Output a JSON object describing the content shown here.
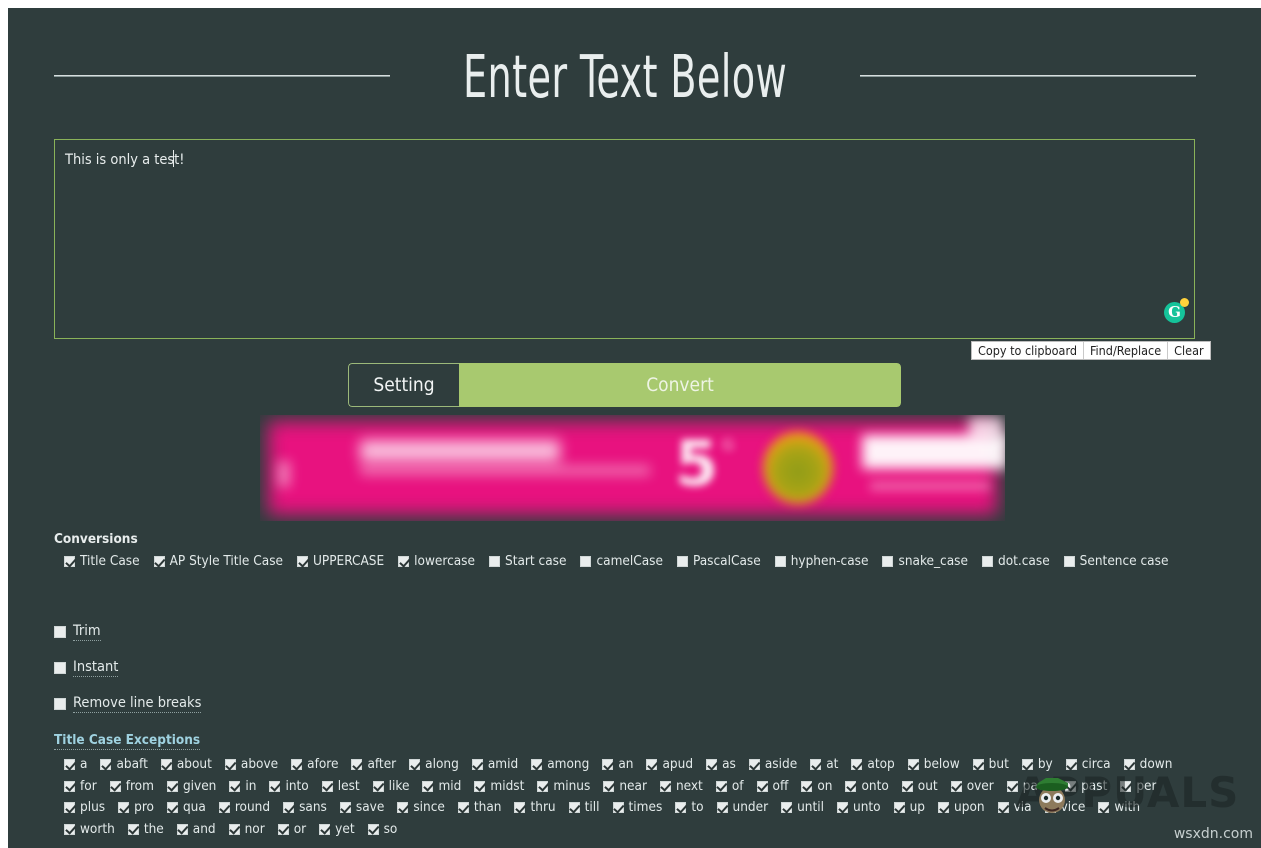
{
  "page": {
    "title": "Enter Text Below",
    "background_color": "#2f3d3d",
    "accent_green": "#a8c96f",
    "watermark": "APPUALS",
    "site_watermark": "wsxdn.com"
  },
  "editor": {
    "value": "This is only a test!",
    "placeholder": "",
    "border_color": "#8ab259",
    "grammarly_letter": "G"
  },
  "editor_actions": [
    {
      "label": "Copy to clipboard",
      "name": "copy-to-clipboard-button"
    },
    {
      "label": "Find/Replace",
      "name": "find-replace-button"
    },
    {
      "label": "Clear",
      "name": "clear-button"
    }
  ],
  "segmented": {
    "setting_label": "Setting",
    "convert_label": "Convert"
  },
  "conversions": {
    "heading": "Conversions",
    "items": [
      {
        "label": "Title Case",
        "checked": true
      },
      {
        "label": "AP Style Title Case",
        "checked": true
      },
      {
        "label": "UPPERCASE",
        "checked": true
      },
      {
        "label": "lowercase",
        "checked": true
      },
      {
        "label": "Start case",
        "checked": false
      },
      {
        "label": "camelCase",
        "checked": false
      },
      {
        "label": "PascalCase",
        "checked": false
      },
      {
        "label": "hyphen-case",
        "checked": false
      },
      {
        "label": "snake_case",
        "checked": false
      },
      {
        "label": "dot.case",
        "checked": false
      },
      {
        "label": "Sentence case",
        "checked": false
      }
    ]
  },
  "options": [
    {
      "label": "Trim",
      "checked": false
    },
    {
      "label": "Instant",
      "checked": false
    },
    {
      "label": "Remove line breaks",
      "checked": false
    }
  ],
  "exceptions": {
    "heading": "Title Case Exceptions",
    "items": [
      {
        "label": "a",
        "checked": true
      },
      {
        "label": "abaft",
        "checked": true
      },
      {
        "label": "about",
        "checked": true
      },
      {
        "label": "above",
        "checked": true
      },
      {
        "label": "afore",
        "checked": true
      },
      {
        "label": "after",
        "checked": true
      },
      {
        "label": "along",
        "checked": true
      },
      {
        "label": "amid",
        "checked": true
      },
      {
        "label": "among",
        "checked": true
      },
      {
        "label": "an",
        "checked": true
      },
      {
        "label": "apud",
        "checked": true
      },
      {
        "label": "as",
        "checked": true
      },
      {
        "label": "aside",
        "checked": true
      },
      {
        "label": "at",
        "checked": true
      },
      {
        "label": "atop",
        "checked": true
      },
      {
        "label": "below",
        "checked": true
      },
      {
        "label": "but",
        "checked": true
      },
      {
        "label": "by",
        "checked": true
      },
      {
        "label": "circa",
        "checked": true
      },
      {
        "label": "down",
        "checked": true
      },
      {
        "label": "for",
        "checked": true
      },
      {
        "label": "from",
        "checked": true
      },
      {
        "label": "given",
        "checked": true
      },
      {
        "label": "in",
        "checked": true
      },
      {
        "label": "into",
        "checked": true
      },
      {
        "label": "lest",
        "checked": true
      },
      {
        "label": "like",
        "checked": true
      },
      {
        "label": "mid",
        "checked": true
      },
      {
        "label": "midst",
        "checked": true
      },
      {
        "label": "minus",
        "checked": true
      },
      {
        "label": "near",
        "checked": true
      },
      {
        "label": "next",
        "checked": true
      },
      {
        "label": "of",
        "checked": true
      },
      {
        "label": "off",
        "checked": true
      },
      {
        "label": "on",
        "checked": true
      },
      {
        "label": "onto",
        "checked": true
      },
      {
        "label": "out",
        "checked": true
      },
      {
        "label": "over",
        "checked": true
      },
      {
        "label": "pace",
        "checked": true
      },
      {
        "label": "past",
        "checked": true
      },
      {
        "label": "per",
        "checked": true
      },
      {
        "label": "plus",
        "checked": true
      },
      {
        "label": "pro",
        "checked": true
      },
      {
        "label": "qua",
        "checked": true
      },
      {
        "label": "round",
        "checked": true
      },
      {
        "label": "sans",
        "checked": true
      },
      {
        "label": "save",
        "checked": true
      },
      {
        "label": "since",
        "checked": true
      },
      {
        "label": "than",
        "checked": true
      },
      {
        "label": "thru",
        "checked": true
      },
      {
        "label": "till",
        "checked": true
      },
      {
        "label": "times",
        "checked": true
      },
      {
        "label": "to",
        "checked": true
      },
      {
        "label": "under",
        "checked": true
      },
      {
        "label": "until",
        "checked": true
      },
      {
        "label": "unto",
        "checked": true
      },
      {
        "label": "up",
        "checked": true
      },
      {
        "label": "upon",
        "checked": true
      },
      {
        "label": "via",
        "checked": true
      },
      {
        "label": "vice",
        "checked": true
      },
      {
        "label": "with",
        "checked": true
      },
      {
        "label": "worth",
        "checked": true
      },
      {
        "label": "the",
        "checked": true
      },
      {
        "label": "and",
        "checked": true
      },
      {
        "label": "nor",
        "checked": true
      },
      {
        "label": "or",
        "checked": true
      },
      {
        "label": "yet",
        "checked": true
      },
      {
        "label": "so",
        "checked": true
      }
    ]
  },
  "advertisement": {
    "visible_text": "5",
    "background_color": "#e8127f"
  }
}
